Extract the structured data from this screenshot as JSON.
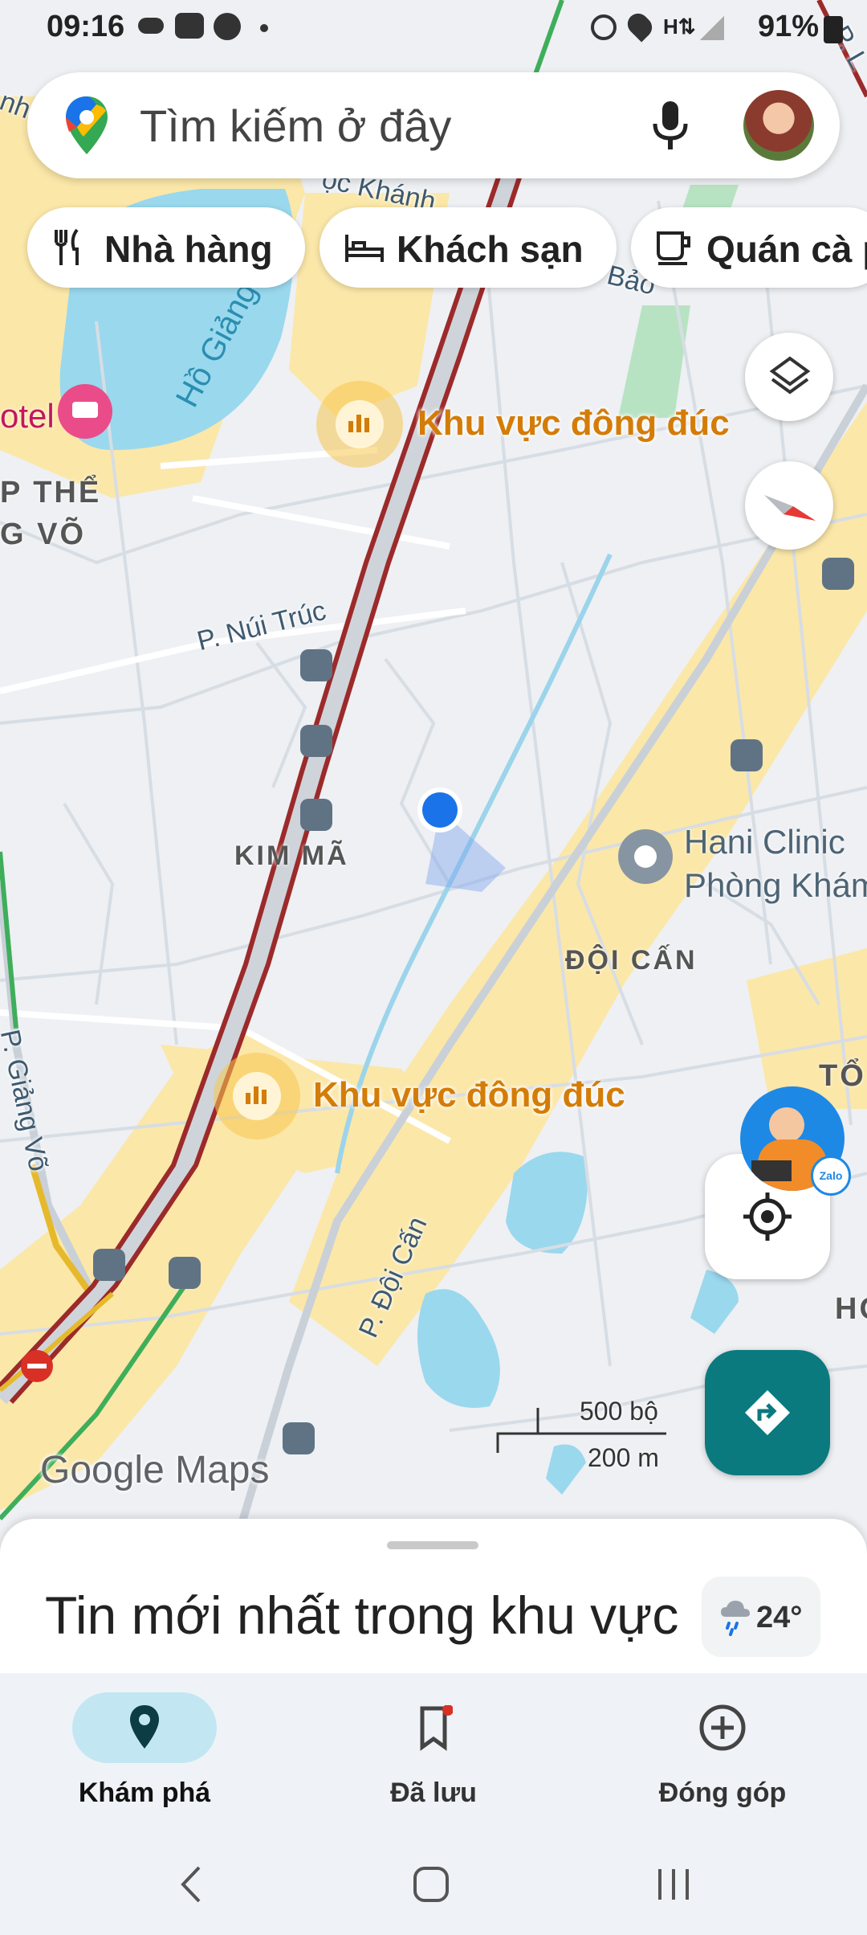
{
  "status_bar": {
    "time": "09:16",
    "battery": "91%",
    "notification_icons": [
      "cloud-icon",
      "zalo-icon",
      "messenger-icon",
      "dot-icon"
    ],
    "system_icons": [
      "alarm-icon",
      "location-icon",
      "data-icon",
      "signal-icon",
      "battery-icon"
    ]
  },
  "search": {
    "placeholder": "Tìm kiếm ở đây",
    "mic_icon": "mic-icon",
    "avatar": "profile-avatar"
  },
  "chips": [
    {
      "label": "Nhà hàng",
      "icon": "restaurant-icon"
    },
    {
      "label": "Khách sạn",
      "icon": "hotel-icon"
    },
    {
      "label": "Quán cà phê",
      "icon": "coffee-icon"
    }
  ],
  "map": {
    "labels": {
      "crowd_1": "Khu vực đông đúc",
      "crowd_2": "Khu vực đông đúc",
      "kim_ma": "KIM MÃ",
      "doi_can": "ĐỘI CẤN",
      "nui_truc": "P. Núi Trúc",
      "giang_vo_street": "P. Giảng Võ",
      "doi_can_street": "P. Đội Cấn",
      "lake": "Hồ Giảng Võ",
      "hotel": "otel",
      "area_left": "P THỂ",
      "area_left_2": "G VÕ",
      "clinic_1": "Hani Clinic",
      "clinic_2": "Phòng Khám",
      "top_street": "ọc Khánh",
      "top_bao": "Bảo",
      "top_right_street": "P. L",
      "top_left": "nh",
      "to_right": "TỔ",
      "ho_right": "HO",
      "scale_ft": "500 bộ",
      "scale_m": "200 m",
      "brand": "Google Maps"
    },
    "colors": {
      "road_main": "#9c2a2a",
      "water": "#9ad8ee",
      "highlight_area": "#fbe7a8",
      "location_dot": "#1a73e8",
      "directions": "#0a7a7f",
      "crowd": "#d47c08"
    }
  },
  "buttons": {
    "layers": "layers-icon",
    "compass": "compass-icon",
    "my_location": "my-location-icon",
    "directions": "directions-icon"
  },
  "sheet": {
    "title": "Tin mới nhất trong khu vực",
    "weather": "24°",
    "weather_icon": "rain-cloud-icon"
  },
  "nav": {
    "items": [
      {
        "label": "Khám phá",
        "icon": "explore-pin-icon",
        "active": true
      },
      {
        "label": "Đã lưu",
        "icon": "bookmark-icon",
        "active": false
      },
      {
        "label": "Đóng góp",
        "icon": "add-circle-icon",
        "active": false
      }
    ]
  },
  "system_nav": [
    "back-icon",
    "home-icon",
    "recents-icon"
  ]
}
